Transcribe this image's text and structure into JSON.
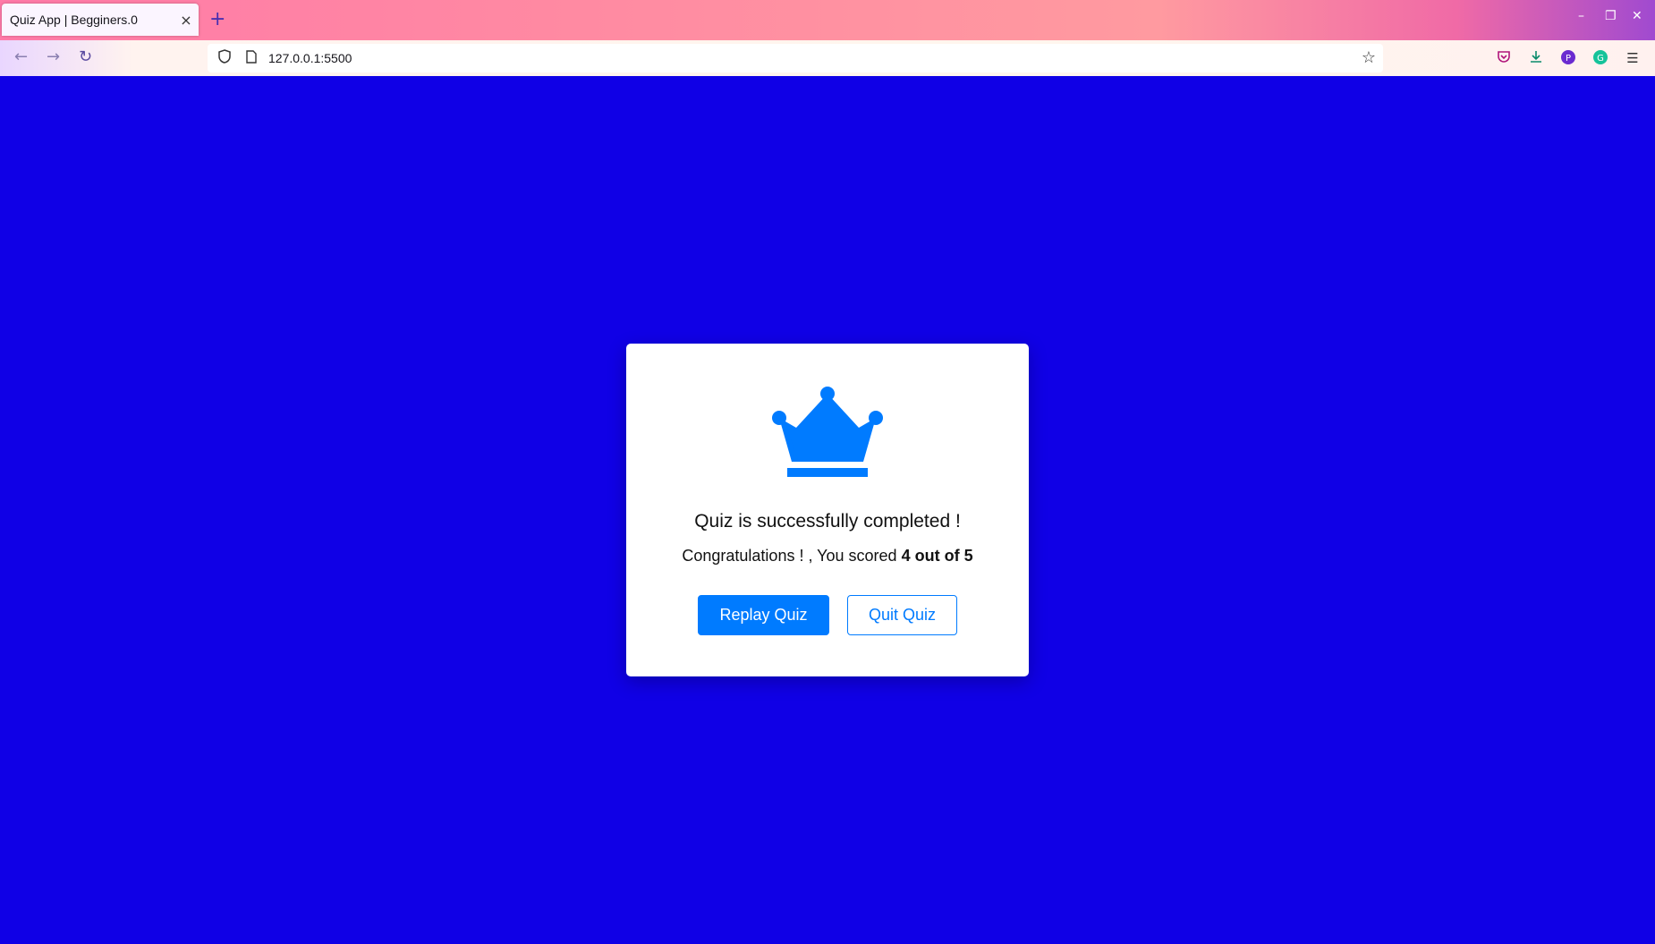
{
  "browser": {
    "tab": {
      "title": "Quiz App | Begginers.0",
      "close_symbol": "×"
    },
    "new_tab_symbol": "+",
    "url": "127.0.0.1:5500",
    "window_controls": {
      "minimize": "–",
      "restore": "❐",
      "close": "✕"
    }
  },
  "quiz_result": {
    "icon": "crown-icon",
    "complete_text": "Quiz is successfully completed !",
    "score_prefix": "Congratulations ! , You scored",
    "score": "4",
    "score_middle": "out of",
    "total": "5",
    "replay_label": "Replay Quiz",
    "quit_label": "Quit Quiz"
  },
  "colors": {
    "page_background": "#1000e6",
    "accent": "#007bff",
    "card_background": "#ffffff"
  }
}
